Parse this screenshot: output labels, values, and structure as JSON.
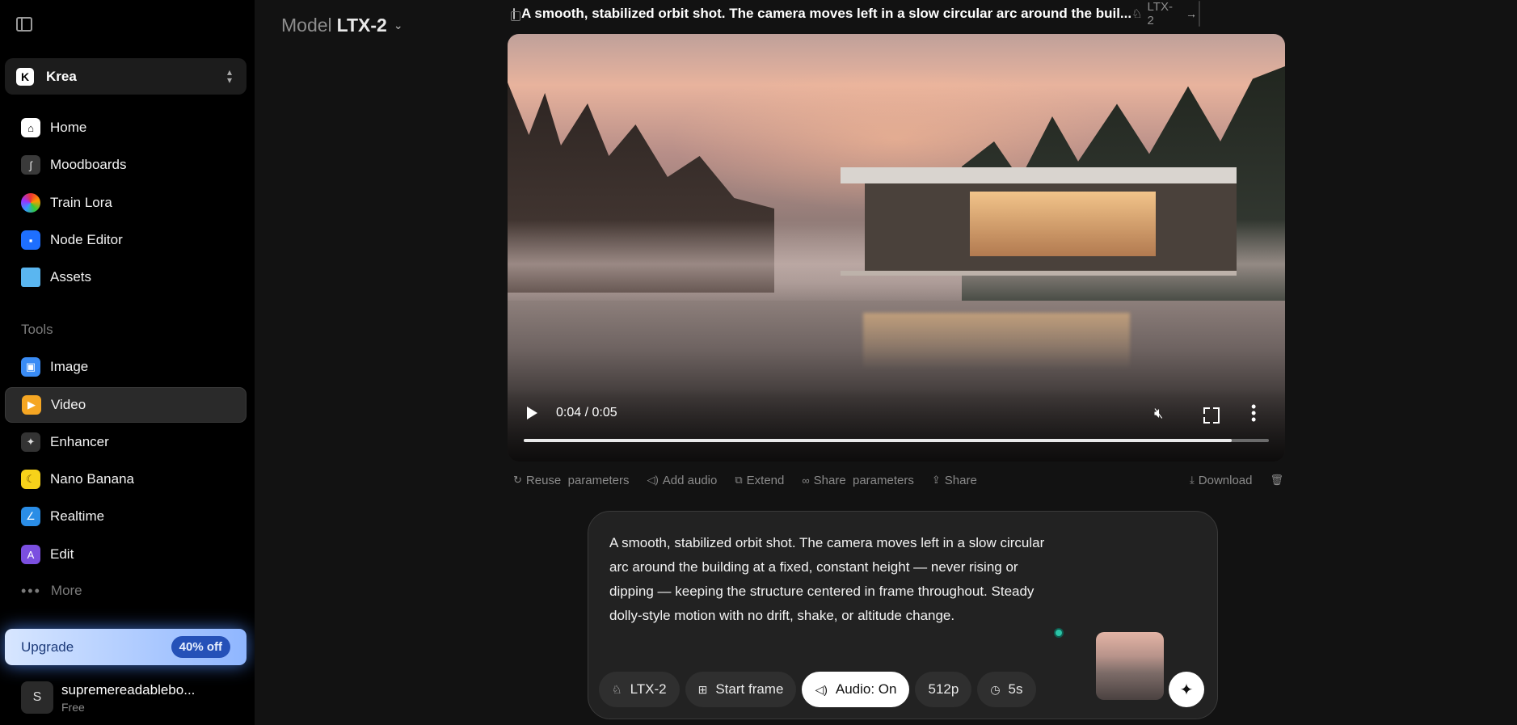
{
  "sidebar": {
    "workspace": {
      "logo": "K",
      "name": "Krea"
    },
    "nav": [
      {
        "label": "Home",
        "icon": "home-icon"
      },
      {
        "label": "Moodboards",
        "icon": "moodboard-icon"
      },
      {
        "label": "Train Lora",
        "icon": "train-lora-icon"
      },
      {
        "label": "Node Editor",
        "icon": "node-editor-icon"
      },
      {
        "label": "Assets",
        "icon": "folder-icon"
      }
    ],
    "tools_title": "Tools",
    "tools": [
      {
        "label": "Image",
        "icon": "image-icon"
      },
      {
        "label": "Video",
        "icon": "video-icon",
        "active": true
      },
      {
        "label": "Enhancer",
        "icon": "enhancer-icon"
      },
      {
        "label": "Nano Banana",
        "icon": "banana-icon"
      },
      {
        "label": "Realtime",
        "icon": "realtime-icon"
      },
      {
        "label": "Edit",
        "icon": "edit-icon"
      }
    ],
    "more_label": "More",
    "upgrade": {
      "label": "Upgrade",
      "badge": "40% off"
    },
    "user": {
      "initial": "S",
      "name": "supremereadablebo...",
      "plan": "Free"
    }
  },
  "header": {
    "model_prefix": "Model",
    "model_name": "LTX-2",
    "generation_title": "A smooth, stabilized orbit shot. The camera moves left in a slow circular arc around the buil...",
    "generation_model": "LTX-2"
  },
  "video": {
    "time": "0:04 / 0:05",
    "progress": 0.95
  },
  "actions": {
    "reuse": "Reuse  parameters",
    "add_audio": "Add audio",
    "extend": "Extend",
    "share_parameters": "Share  parameters",
    "share": "Share",
    "download": "Download"
  },
  "prompt": {
    "text": "A smooth, stabilized orbit shot. The camera moves left in a slow circular arc around the building at a fixed, constant height — never rising or dipping — keeping the structure centered in frame throughout. Steady dolly-style motion with no drift, shake, or altitude change.",
    "pills": {
      "model": "LTX-2",
      "start_frame": "Start frame",
      "audio": "Audio: On",
      "resolution": "512p",
      "duration": "5s"
    }
  },
  "colors": {
    "accent_upgrade": "#8fb6ff",
    "cursor": "#2bc4a7",
    "active_item": "#2a2a2a"
  }
}
